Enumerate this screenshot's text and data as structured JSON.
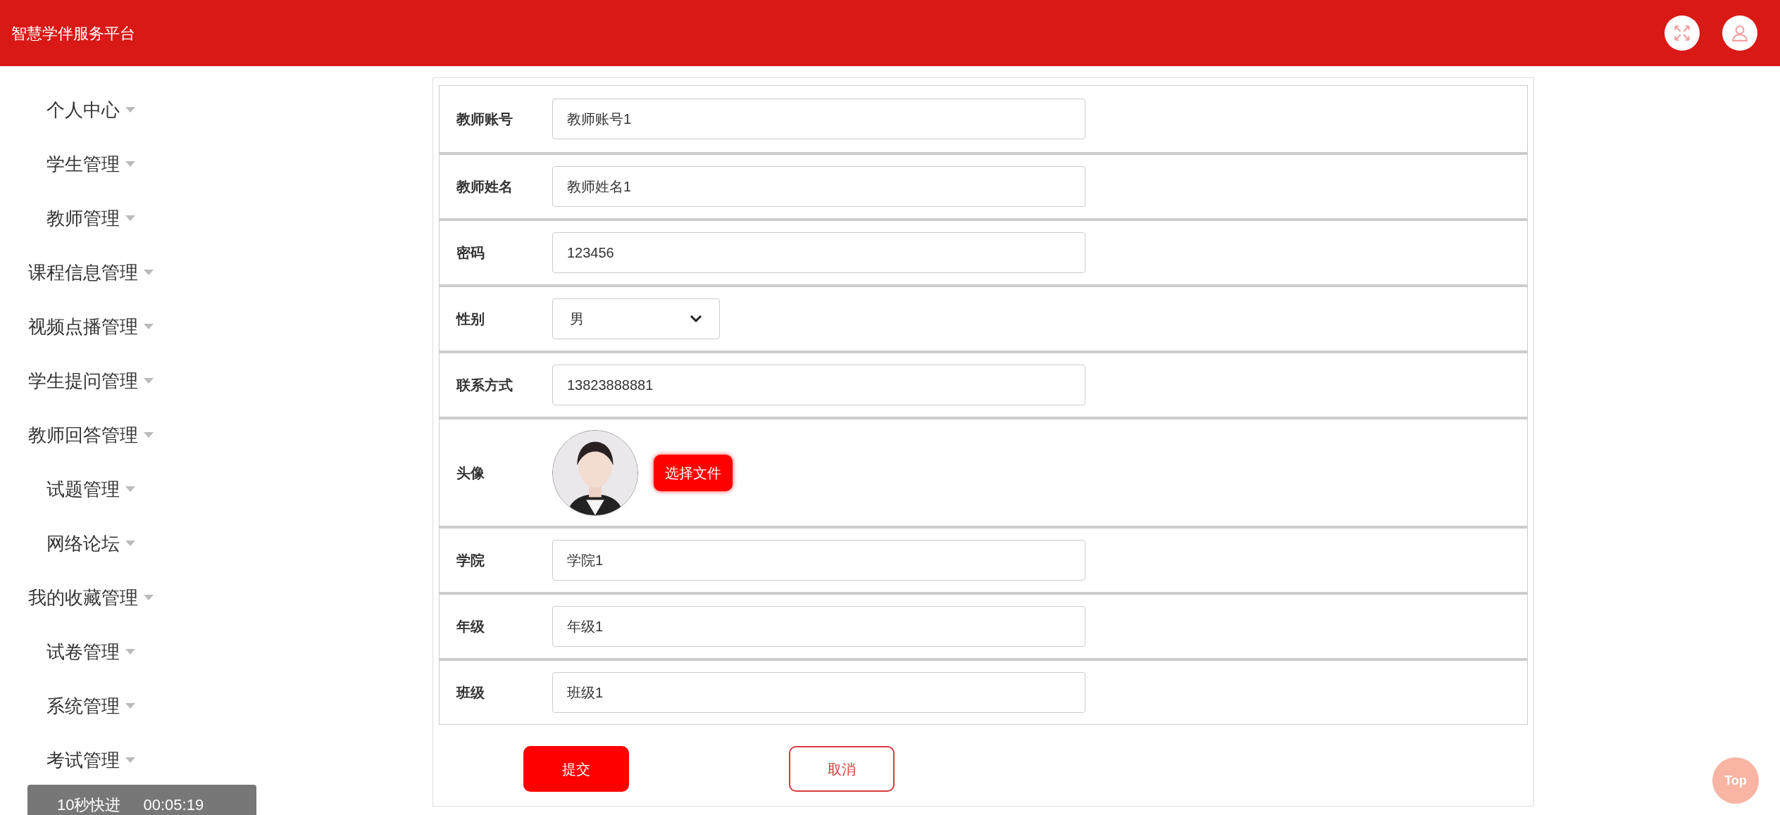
{
  "header": {
    "title": "智慧学伴服务平台"
  },
  "sidebar": {
    "items": [
      {
        "label": "个人中心"
      },
      {
        "label": "学生管理"
      },
      {
        "label": "教师管理"
      },
      {
        "label": "课程信息管理"
      },
      {
        "label": "视频点播管理"
      },
      {
        "label": "学生提问管理"
      },
      {
        "label": "教师回答管理"
      },
      {
        "label": "试题管理"
      },
      {
        "label": "网络论坛"
      },
      {
        "label": "我的收藏管理"
      },
      {
        "label": "试卷管理"
      },
      {
        "label": "系统管理"
      },
      {
        "label": "考试管理"
      }
    ]
  },
  "form": {
    "fields": [
      {
        "kind": "text",
        "label": "教师账号",
        "value": "教师账号1"
      },
      {
        "kind": "text",
        "label": "教师姓名",
        "value": "教师姓名1"
      },
      {
        "kind": "text",
        "label": "密码",
        "value": "123456"
      },
      {
        "kind": "select",
        "label": "性别",
        "value": "男"
      },
      {
        "kind": "text",
        "label": "联系方式",
        "value": "13823888881"
      },
      {
        "label": "头像",
        "button": "选择文件"
      },
      {
        "kind": "text",
        "label": "学院",
        "value": "学院1"
      },
      {
        "kind": "text",
        "label": "年级",
        "value": "年级1"
      },
      {
        "kind": "text",
        "label": "班级",
        "value": "班级1"
      }
    ],
    "buttons": [
      {
        "kind": "primary",
        "label": "提交"
      },
      {
        "kind": "outline",
        "label": "取消"
      }
    ]
  },
  "back_to_top": {
    "label": "Top"
  },
  "video_overlay": {
    "skip": "10秒快进",
    "time": "00:05:19"
  }
}
